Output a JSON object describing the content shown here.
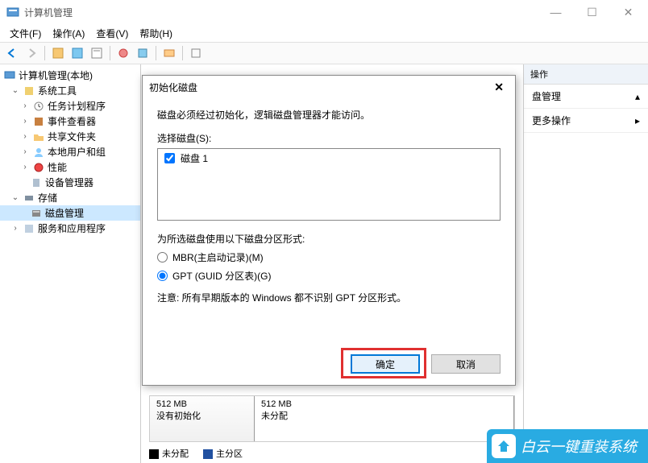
{
  "window": {
    "title": "计算机管理",
    "controls": {
      "min": "—",
      "max": "☐",
      "close": "✕"
    }
  },
  "menubar": [
    {
      "label": "文件(F)"
    },
    {
      "label": "操作(A)"
    },
    {
      "label": "查看(V)"
    },
    {
      "label": "帮助(H)"
    }
  ],
  "tree": {
    "root": "计算机管理(本地)",
    "sys_tools": "系统工具",
    "task_scheduler": "任务计划程序",
    "event_viewer": "事件查看器",
    "shared_folders": "共享文件夹",
    "local_users": "本地用户和组",
    "performance": "性能",
    "device_mgr": "设备管理器",
    "storage": "存储",
    "disk_mgmt": "磁盘管理",
    "services": "服务和应用程序"
  },
  "actions": {
    "header": "操作",
    "disk_mgmt": "盘管理",
    "more": "更多操作"
  },
  "dialog": {
    "title": "初始化磁盘",
    "message": "磁盘必须经过初始化，逻辑磁盘管理器才能访问。",
    "select_label": "选择磁盘(S):",
    "disk_item": "磁盘 1",
    "partition_label": "为所选磁盘使用以下磁盘分区形式:",
    "mbr": "MBR(主启动记录)(M)",
    "gpt": "GPT (GUID 分区表)(G)",
    "note": "注意: 所有早期版本的 Windows 都不识别 GPT 分区形式。",
    "ok": "确定",
    "cancel": "取消"
  },
  "disk_panel": {
    "size1": "512 MB",
    "status1": "没有初始化",
    "size2": "512 MB",
    "status2": "未分配"
  },
  "legend": {
    "unalloc": "未分配",
    "primary": "主分区"
  },
  "watermark": "白云一键重装系统"
}
